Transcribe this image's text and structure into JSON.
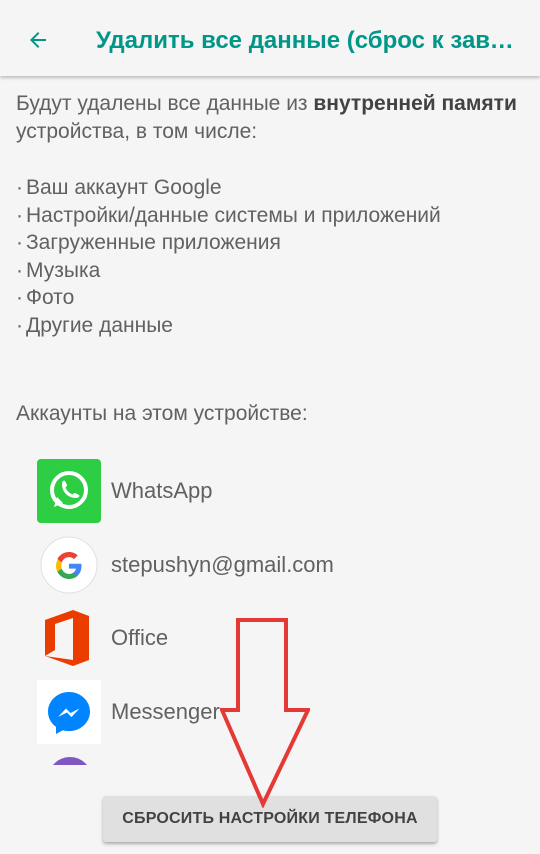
{
  "header": {
    "title": "Удалить все данные (сброс к заводским настройкам)"
  },
  "intro": {
    "before": "Будут удалены все данные из ",
    "bold": "внутренней памяти",
    "after": " устройства, в том числе:"
  },
  "bullets": [
    "Ваш аккаунт Google",
    "Настройки/данные системы и приложений",
    "Загруженные приложения",
    "Музыка",
    "Фото",
    "Другие данные"
  ],
  "accounts_label": "Аккаунты на этом устройстве:",
  "accounts": [
    {
      "label": "WhatsApp",
      "icon": "whatsapp-icon"
    },
    {
      "label": "stepushyn@gmail.com",
      "icon": "google-icon"
    },
    {
      "label": "Office",
      "icon": "office-icon"
    },
    {
      "label": "Messenger",
      "icon": "messenger-icon"
    }
  ],
  "reset_button": "СБРОСИТЬ НАСТРОЙКИ ТЕЛЕФОНА",
  "colors": {
    "accent": "#009688",
    "background": "#f5f5f5",
    "text": "#616161",
    "arrow": "#e53935",
    "whatsapp": "#2dce43",
    "office": "#eb3c00",
    "messenger": "#0084ff"
  }
}
